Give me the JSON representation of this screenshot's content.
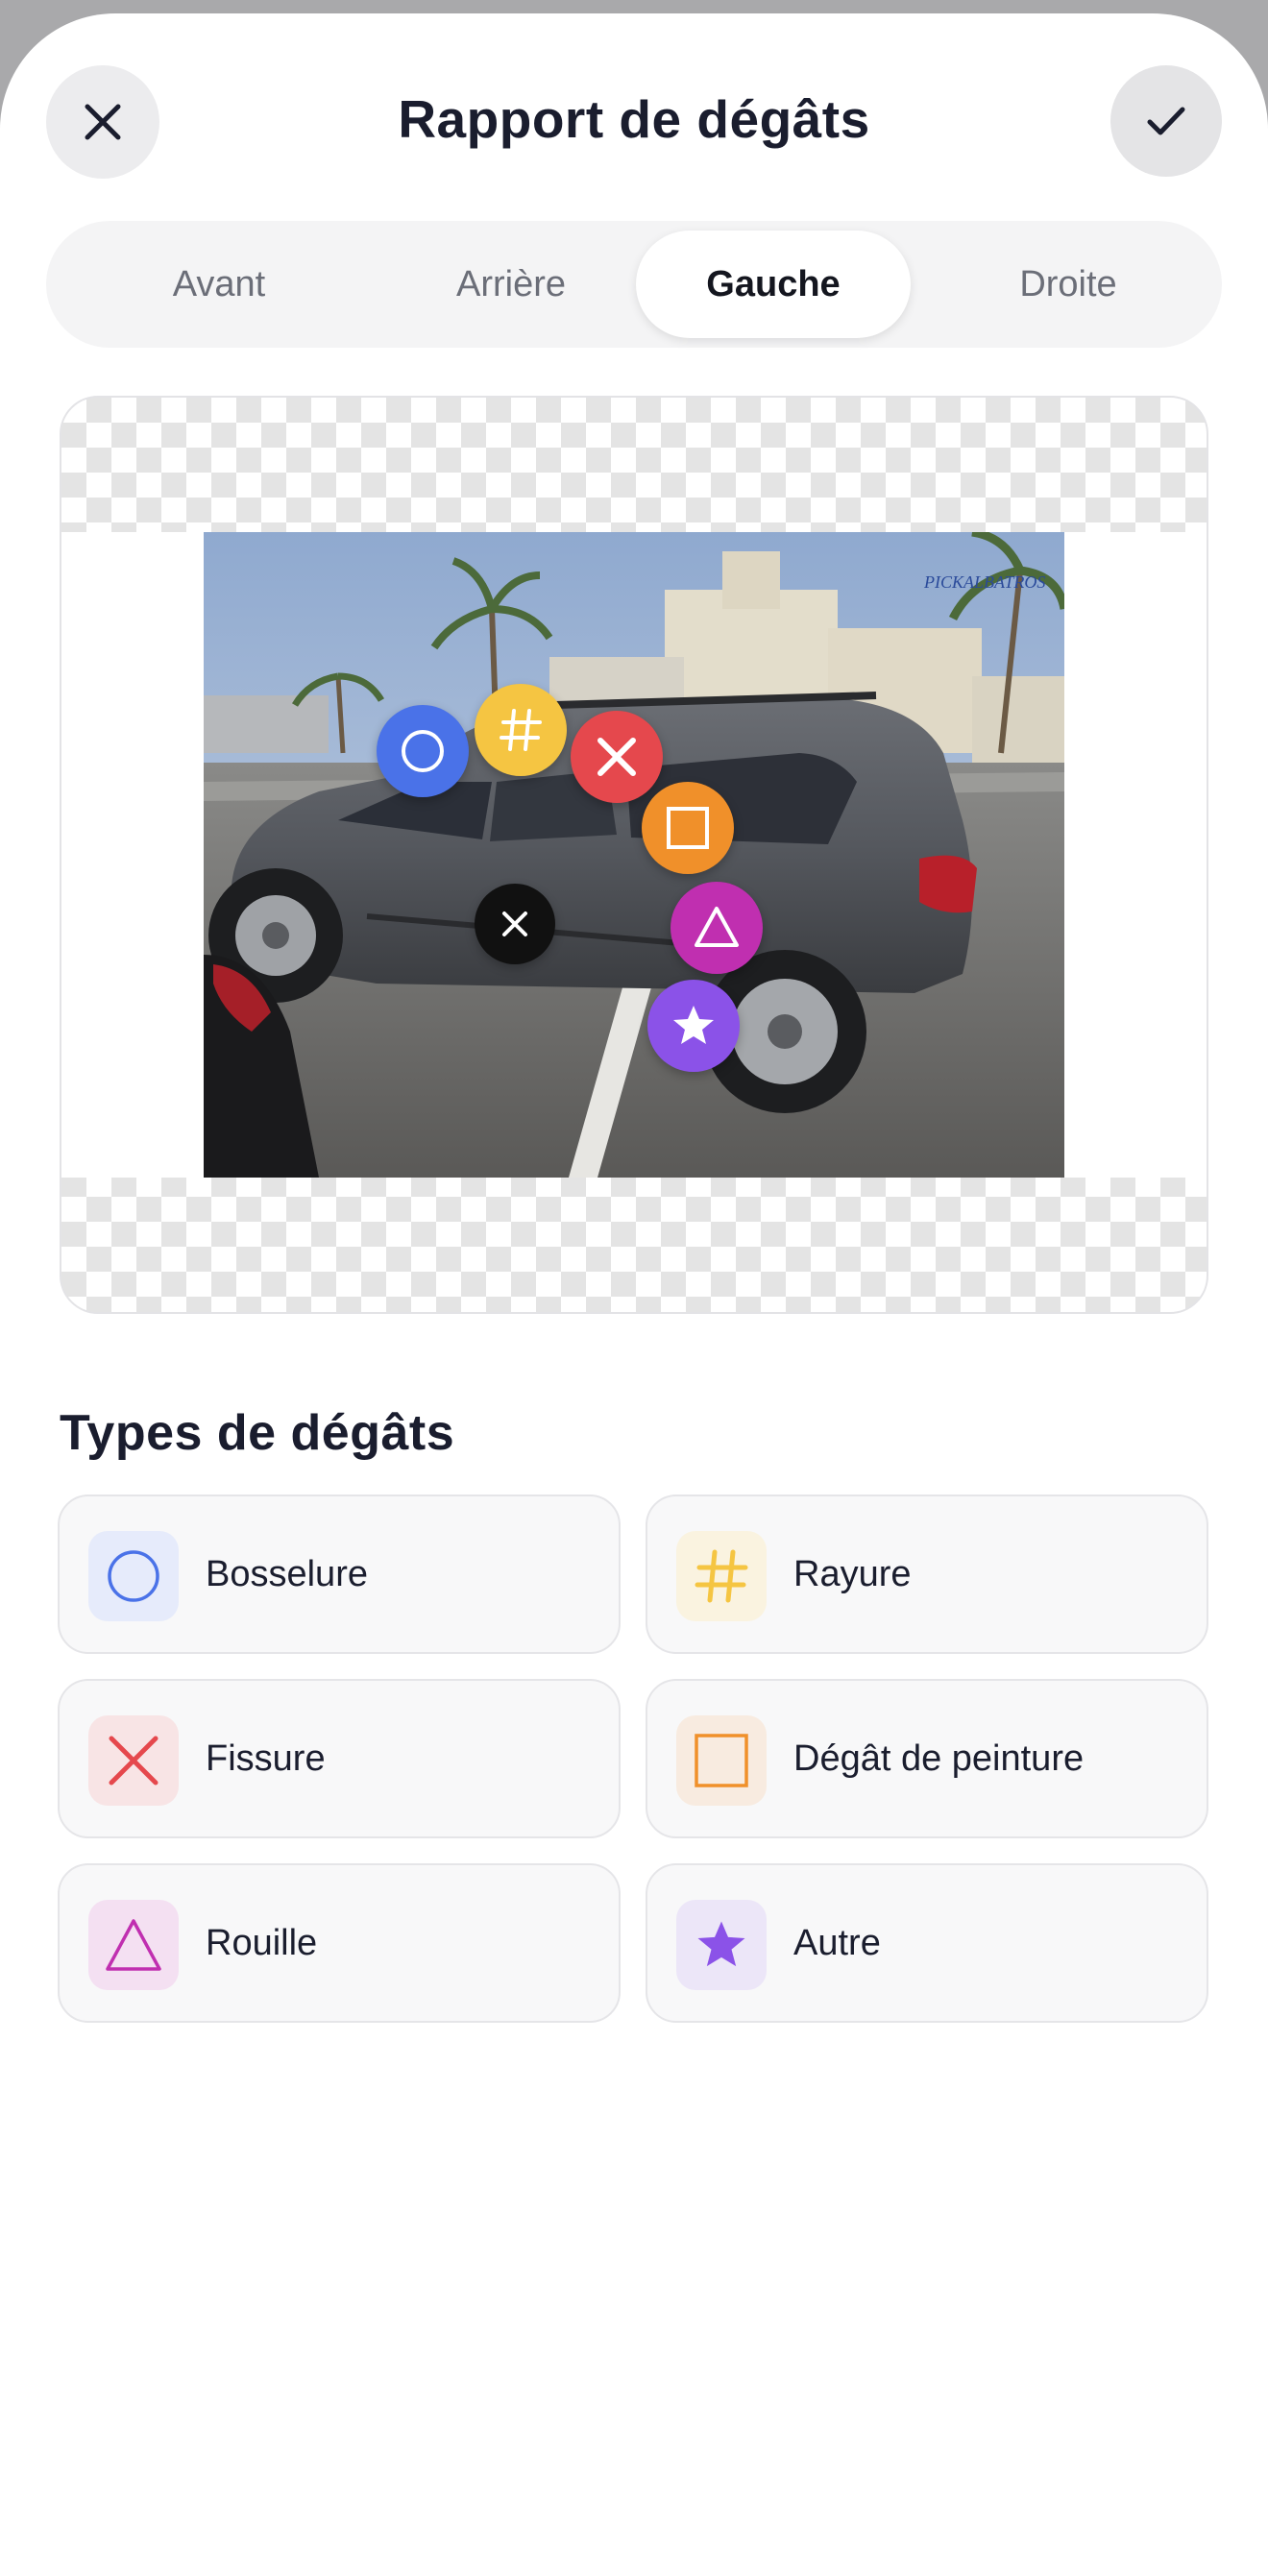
{
  "header": {
    "title": "Rapport de dégâts"
  },
  "tabs": [
    {
      "label": "Avant",
      "selected": false
    },
    {
      "label": "Arrière",
      "selected": false
    },
    {
      "label": "Gauche",
      "selected": true
    },
    {
      "label": "Droite",
      "selected": false
    }
  ],
  "photo": {
    "description_icon": "car-photo-left-side"
  },
  "markers": [
    {
      "type": "Bosselure",
      "icon": "circle-icon",
      "color": "#4a72e8"
    },
    {
      "type": "Rayure",
      "icon": "hash-icon",
      "color": "#f5c542"
    },
    {
      "type": "Fissure",
      "icon": "x-icon",
      "color": "#e5484d"
    },
    {
      "type": "Dégât de peinture",
      "icon": "square-icon",
      "color": "#f0902a"
    },
    {
      "type": "Rouille",
      "icon": "triangle-icon",
      "color": "#c02fb0"
    },
    {
      "type": "Autre",
      "icon": "star-icon",
      "color": "#8b52e8"
    },
    {
      "type": "delete",
      "icon": "close-icon",
      "color": "#111111"
    }
  ],
  "damage_types": {
    "title": "Types de dégâts",
    "items": [
      {
        "label": "Bosselure",
        "icon": "circle-icon",
        "color": "#4a72e8",
        "bg": "#e6ebfb"
      },
      {
        "label": "Rayure",
        "icon": "hash-icon",
        "color": "#f5c542",
        "bg": "#faf3e0"
      },
      {
        "label": "Fissure",
        "icon": "x-icon",
        "color": "#e5484d",
        "bg": "#f8e4e5"
      },
      {
        "label": "Dégât de peinture",
        "icon": "square-icon",
        "color": "#f0902a",
        "bg": "#f8ebe0"
      },
      {
        "label": "Rouille",
        "icon": "triangle-icon",
        "color": "#c02fb0",
        "bg": "#f4e0f2"
      },
      {
        "label": "Autre",
        "icon": "star-icon",
        "color": "#8b52e8",
        "bg": "#ece6f8"
      }
    ]
  }
}
